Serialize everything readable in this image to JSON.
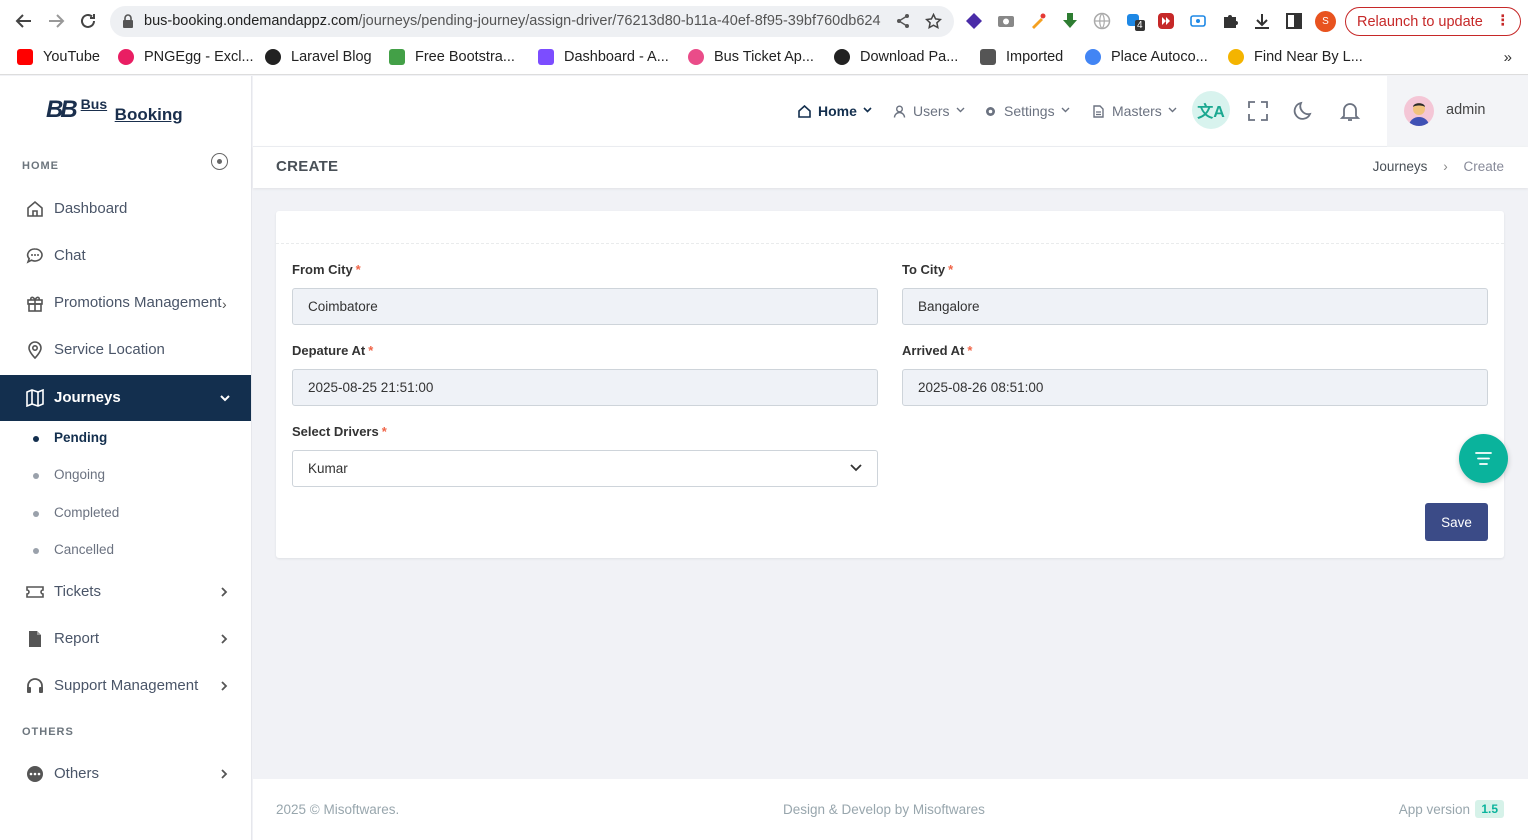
{
  "browser": {
    "url_host": "bus-booking.ondemandappz.com",
    "url_path": "/journeys/pending-journey/assign-driver/76213d80-b11a-40ef-8f95-39bf760db624",
    "relaunch_label": "Relaunch to update",
    "profile_initial": "S",
    "ext_badge": "4",
    "bookmarks": [
      {
        "label": "YouTube",
        "color": "#ff0000"
      },
      {
        "label": "PNGEgg - Excl...",
        "color": "#e91e63"
      },
      {
        "label": "Laravel Blog",
        "color": "#222222"
      },
      {
        "label": "Free Bootstra...",
        "color": "#43a047"
      },
      {
        "label": "Dashboard - A...",
        "color": "#7c4dff"
      },
      {
        "label": "Bus Ticket Ap...",
        "color": "#ea4c89"
      },
      {
        "label": "Download Pa...",
        "color": "#222222"
      },
      {
        "label": "Imported",
        "color": "#555555"
      },
      {
        "label": "Place Autoco...",
        "color": "#4285f4"
      },
      {
        "label": "Find Near By L...",
        "color": "#f4b400"
      }
    ],
    "bookmarks_more": "»"
  },
  "logo": {
    "mark": "BB",
    "line1": "Bus",
    "line2": "Booking"
  },
  "sidebar": {
    "section_home": "HOME",
    "section_others": "OTHERS",
    "items": [
      {
        "label": "Dashboard",
        "icon": "home-icon"
      },
      {
        "label": "Chat",
        "icon": "chat-icon"
      },
      {
        "label": "Promotions Management",
        "icon": "gift-icon"
      },
      {
        "label": "Service Location",
        "icon": "location-icon"
      },
      {
        "label": "Journeys",
        "icon": "map-icon"
      },
      {
        "label": "Tickets",
        "icon": "ticket-icon"
      },
      {
        "label": "Report",
        "icon": "file-icon"
      },
      {
        "label": "Support Management",
        "icon": "headset-icon"
      },
      {
        "label": "Others",
        "icon": "more-icon"
      }
    ],
    "journey_subitems": [
      "Pending",
      "Ongoing",
      "Completed",
      "Cancelled"
    ]
  },
  "topbar": {
    "nav": [
      {
        "label": "Home",
        "icon": "home-icon"
      },
      {
        "label": "Users",
        "icon": "user-icon"
      },
      {
        "label": "Settings",
        "icon": "gear-icon"
      },
      {
        "label": "Masters",
        "icon": "document-icon"
      }
    ],
    "lang_glyph": "文A",
    "username": "admin"
  },
  "page": {
    "title": "CREATE",
    "breadcrumb": [
      "Journeys",
      "Create"
    ],
    "breadcrumb_sep": "›"
  },
  "form": {
    "from_city_label": "From City",
    "from_city_value": "Coimbatore",
    "to_city_label": "To City",
    "to_city_value": "Bangalore",
    "departure_label": "Depature At",
    "departure_value": "2025-08-25 21:51:00",
    "arrived_label": "Arrived At",
    "arrived_value": "2025-08-26 08:51:00",
    "drivers_label": "Select Drivers",
    "drivers_value": "Kumar",
    "required_mark": "*",
    "save_label": "Save"
  },
  "footer": {
    "copyright": "2025 © Misoftwares.",
    "credit": "Design & Develop by Misoftwares",
    "version_label": "App version",
    "version": "1.5"
  },
  "colors": {
    "sidebar_active": "#132f4e",
    "accent": "#0ab39c",
    "save_button": "#3b4b87",
    "required": "#f06548"
  }
}
